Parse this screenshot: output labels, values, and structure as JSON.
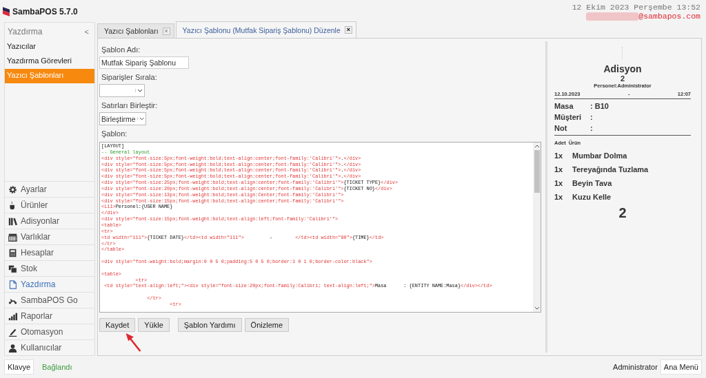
{
  "app": {
    "title": "SambaPOS 5.7.0",
    "datetime": "12 Ekim 2023 Perşembe 13:52",
    "email": "@sambapos.com"
  },
  "sidebar": {
    "header": "Yazdırma",
    "collapse": "<",
    "items": [
      {
        "label": "Yazıcılar",
        "selected": false
      },
      {
        "label": "Yazdırma Görevleri",
        "selected": false
      },
      {
        "label": "Yazıcı Şablonları",
        "selected": true
      }
    ],
    "nav": [
      {
        "label": "Ayarlar",
        "selected": false
      },
      {
        "label": "Ürünler",
        "selected": false
      },
      {
        "label": "Adisyonlar",
        "selected": false
      },
      {
        "label": "Varlıklar",
        "selected": false
      },
      {
        "label": "Hesaplar",
        "selected": false
      },
      {
        "label": "Stok",
        "selected": false
      },
      {
        "label": "Yazdırma",
        "selected": true
      },
      {
        "label": "SambaPOS Go",
        "selected": false
      },
      {
        "label": "Raporlar",
        "selected": false
      },
      {
        "label": "Otomasyon",
        "selected": false
      },
      {
        "label": "Kullanıcılar",
        "selected": false
      }
    ]
  },
  "tabs": [
    {
      "label": "Yazıcı Şablonları",
      "close": "×",
      "selected": false
    },
    {
      "label": "Yazıcı Şablonu (Mutfak Sipariş Şablonu) Düzenle",
      "close": "×",
      "selected": true
    }
  ],
  "form": {
    "name_label": "Şablon Adı:",
    "name_value": "Mutfak Sipariş Şablonu",
    "sort_label": "Siparişler Sırala:",
    "merge_label": "Satırları Birleştir:",
    "merge_value": "Birleştirme",
    "template_label": "Şablon:",
    "code_lines": [
      {
        "kind": "code",
        "segments": [
          {
            "kind": "text",
            "text": "[LAYOUT]"
          }
        ]
      },
      {
        "kind": "code",
        "segments": [
          {
            "kind": "comment",
            "text": "-- General layout"
          }
        ]
      },
      {
        "kind": "code",
        "segments": [
          {
            "kind": "markup",
            "text": "<div style=\"font-size:5px;font-weight:bold;text-align:center;font-family:'Calibri'\">"
          },
          {
            "kind": "text",
            "text": "."
          },
          {
            "kind": "markup",
            "text": "</div>"
          }
        ]
      },
      {
        "kind": "code",
        "segments": [
          {
            "kind": "markup",
            "text": "<div style=\"font-size:5px;font-weight:bold;text-align:center;font-family:'Calibri'\">"
          },
          {
            "kind": "text",
            "text": "."
          },
          {
            "kind": "markup",
            "text": "</div>"
          }
        ]
      },
      {
        "kind": "code",
        "segments": [
          {
            "kind": "markup",
            "text": "<div style=\"font-size:5px;font-weight:bold;text-align:center;font-family:'Calibri'\">"
          },
          {
            "kind": "text",
            "text": "."
          },
          {
            "kind": "markup",
            "text": "</div>"
          }
        ]
      },
      {
        "kind": "code",
        "segments": [
          {
            "kind": "markup",
            "text": "<div style=\"font-size:5px;font-weight:bold;text-align:center;font-family:'Calibri'\">"
          },
          {
            "kind": "text",
            "text": "."
          },
          {
            "kind": "markup",
            "text": "</div>"
          }
        ]
      },
      {
        "kind": "code",
        "segments": [
          {
            "kind": "markup",
            "text": "<div style=\"font-size:25px;font-weight:bold;text-align:center;font-family:'Calibri'\">"
          },
          {
            "kind": "text",
            "text": "{TICKET TYPE}"
          },
          {
            "kind": "markup",
            "text": "</div>"
          }
        ]
      },
      {
        "kind": "code",
        "segments": [
          {
            "kind": "markup",
            "text": "<div style=\"font-size:20px;font-weight:bold;text-align:center;font-family:'Calibri'\">"
          },
          {
            "kind": "text",
            "text": "{TICKET NO}"
          },
          {
            "kind": "markup",
            "text": "</div>"
          }
        ]
      },
      {
        "kind": "code",
        "segments": [
          {
            "kind": "markup",
            "text": "<div style=\"font-size:13px;font-weight:bold;text-align:Center;font-family:'Calibri'\">"
          }
        ]
      },
      {
        "kind": "code",
        "segments": [
          {
            "kind": "markup",
            "text": "<div style=\"font-size:15px;font-weight:bold;text-align:center;font-family:'Calibri'\">"
          }
        ]
      },
      {
        "kind": "code",
        "segments": [
          {
            "kind": "markup",
            "text": "<L11>"
          },
          {
            "kind": "text",
            "text": "Personel:{USER NAME}"
          }
        ]
      },
      {
        "kind": "code",
        "segments": [
          {
            "kind": "markup",
            "text": "</div>"
          }
        ]
      },
      {
        "kind": "code",
        "segments": [
          {
            "kind": "markup",
            "text": "<div style=\"font-size:15px;font-weight:bold;text-align:left;font-family:'Calibri'\">"
          }
        ]
      },
      {
        "kind": "code",
        "segments": [
          {
            "kind": "markup",
            "text": "<table>"
          }
        ]
      },
      {
        "kind": "code",
        "segments": [
          {
            "kind": "markup",
            "text": "<tr>"
          }
        ]
      },
      {
        "kind": "code",
        "segments": [
          {
            "kind": "markup",
            "text": "<td width=\"111\">"
          },
          {
            "kind": "text",
            "text": "{TICKET DATE}"
          },
          {
            "kind": "markup",
            "text": "</td><td width=\"111\">"
          },
          {
            "kind": "text",
            "text": "         -        "
          },
          {
            "kind": "markup",
            "text": "</td><td width=\"90\">"
          },
          {
            "kind": "text",
            "text": "{TIME}"
          },
          {
            "kind": "markup",
            "text": "</td>"
          }
        ]
      },
      {
        "kind": "code",
        "segments": [
          {
            "kind": "markup",
            "text": "</tr>"
          }
        ]
      },
      {
        "kind": "code",
        "segments": [
          {
            "kind": "markup",
            "text": "</table>"
          }
        ]
      },
      {
        "kind": "blank"
      },
      {
        "kind": "code",
        "segments": [
          {
            "kind": "markup",
            "text": "<div style=\"font-weight:bold;margin:0 0 5 0;padding:5 0 5 0;border:1 0 1 0;border-color:black\">"
          }
        ]
      },
      {
        "kind": "blank"
      },
      {
        "kind": "code",
        "segments": [
          {
            "kind": "markup",
            "text": "<table>"
          }
        ]
      },
      {
        "kind": "code",
        "segments": [
          {
            "kind": "markup",
            "text": "            <tr>"
          }
        ]
      },
      {
        "kind": "code",
        "segments": [
          {
            "kind": "markup",
            "text": " <td style=\"text-align:left;\"><div style=\"font-size:20px;font-family:Calibri; text-align:left;\">"
          },
          {
            "kind": "text",
            "text": "Masa      : {ENTITY NAME:Masa}"
          },
          {
            "kind": "markup",
            "text": "</div></td>"
          }
        ]
      },
      {
        "kind": "blank"
      },
      {
        "kind": "code",
        "segments": [
          {
            "kind": "markup",
            "text": "                </tr>"
          }
        ]
      },
      {
        "kind": "code",
        "segments": [
          {
            "kind": "markup",
            "text": "                        <tr>"
          }
        ]
      }
    ]
  },
  "buttons": [
    "Kaydet",
    "Yükle",
    "Şablon Yardımı",
    "Önizleme"
  ],
  "preview": {
    "title": "Adisyon",
    "number": "2",
    "user": "Personel:Administrator",
    "date": "12.10.2023",
    "dash": "-",
    "time": "12:07",
    "fields": [
      {
        "label": "Masa",
        "value": ": B10"
      },
      {
        "label": "Müşteri",
        "value": ":"
      },
      {
        "label": "Not",
        "value": ":"
      }
    ],
    "col_qty": "Adet",
    "col_product": "Ürün",
    "items": [
      {
        "qty": "1x",
        "name": "Mumbar Dolma"
      },
      {
        "qty": "1x",
        "name": "Tereyağında Tuzlama"
      },
      {
        "qty": "1x",
        "name": "Beyin Tava"
      },
      {
        "qty": "1x",
        "name": "Kuzu Kelle"
      }
    ],
    "total": "2"
  },
  "status_bar": {
    "keyboard": "Klavye",
    "connection": "Bağlandı",
    "user": "Administrator",
    "menu": "Ana Menü"
  }
}
